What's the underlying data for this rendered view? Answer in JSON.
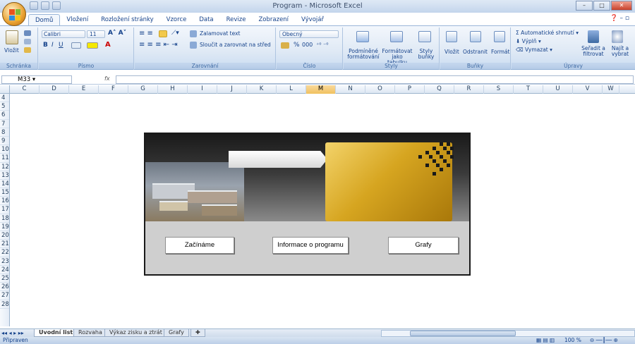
{
  "window": {
    "title": "Program - Microsoft Excel"
  },
  "tabs": [
    "Domů",
    "Vložení",
    "Rozložení stránky",
    "Vzorce",
    "Data",
    "Revize",
    "Zobrazení",
    "Vývojář"
  ],
  "ribbon": {
    "clipboard": {
      "paste": "Vložit",
      "label": "Schránka"
    },
    "font": {
      "name": "Calibri",
      "size": "11",
      "bold": "B",
      "italic": "I",
      "underline": "U",
      "label": "Písmo"
    },
    "alignment": {
      "wrap": "Zalamovat text",
      "merge": "Sloučit a zarovnat na střed",
      "label": "Zarovnání"
    },
    "number": {
      "format": "Obecný",
      "percent": "%",
      "thousands": "000",
      "label": "Číslo"
    },
    "styles": {
      "conditional": "Podmíněné formátování",
      "table": "Formátovat jako tabulku",
      "cell": "Styly buňky",
      "label": "Styly"
    },
    "cells": {
      "insert": "Vložit",
      "delete": "Odstranit",
      "format": "Formát",
      "label": "Buňky"
    },
    "editing": {
      "autosum": "Automatické shrnutí",
      "fill": "Výplň",
      "clear": "Vymazat",
      "sort": "Seřadit a filtrovat",
      "find": "Najít a vybrat",
      "label": "Úpravy"
    }
  },
  "namebox": "M33",
  "fx": "fx",
  "columns": [
    "C",
    "D",
    "E",
    "F",
    "G",
    "H",
    "I",
    "J",
    "K",
    "L",
    "M",
    "N",
    "O",
    "P",
    "Q",
    "R",
    "S",
    "T",
    "U",
    "V",
    "W"
  ],
  "selected_column": "M",
  "rows": [
    "4",
    "5",
    "6",
    "7",
    "8",
    "9",
    "10",
    "11",
    "12",
    "13",
    "14",
    "15",
    "16",
    "17",
    "18",
    "19",
    "20",
    "21",
    "22",
    "23",
    "24",
    "25",
    "26",
    "27",
    "28"
  ],
  "panel": {
    "buttons": [
      "Začínáme",
      "Informace o programu",
      "Grafy"
    ]
  },
  "sheets": [
    "Uvodní list",
    "Rozvaha",
    "Výkaz zisku a ztrát",
    "Grafy"
  ],
  "active_sheet": "Uvodní list",
  "status": {
    "left": "Připraven",
    "zoom": "100 %"
  }
}
